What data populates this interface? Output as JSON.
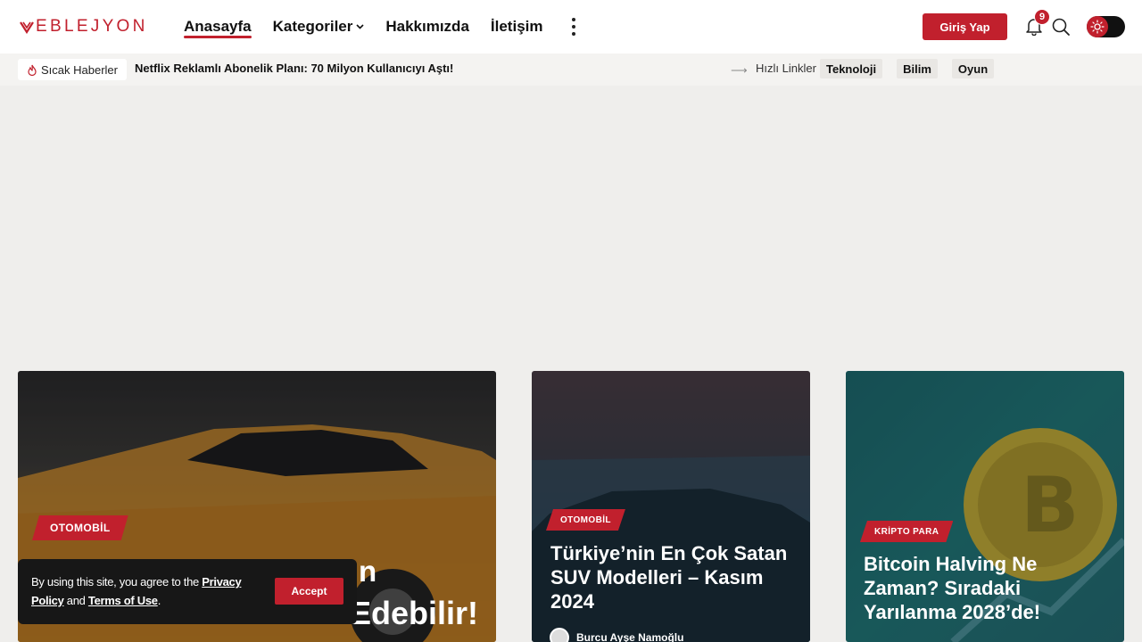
{
  "brand": {
    "logo_text": "EBLEJYON",
    "accent": "#c1202d"
  },
  "nav": {
    "items": [
      {
        "label": "Anasayfa",
        "active": true
      },
      {
        "label": "Kategoriler",
        "has_dropdown": true
      },
      {
        "label": "Hakkımızda"
      },
      {
        "label": "İletişim"
      }
    ],
    "more_icon": "more-vertical-icon"
  },
  "header": {
    "login_label": "Giriş Yap",
    "notification_count": "9",
    "icons": [
      "bell-icon",
      "search-icon",
      "sun-icon"
    ]
  },
  "ticker": {
    "hot_label": "Sıcak Haberler",
    "headline": "Netflix Reklamlı Abonelik Planı: 70 Milyon Kullanıcıyı Aştı!",
    "quick_label": "Hızlı Linkler",
    "quick_links": [
      "Teknoloji",
      "Bilim",
      "Oyun"
    ]
  },
  "cards": [
    {
      "category": "OTOMOBİL",
      "title_visible": "Edebilir!",
      "title_partial": "n"
    },
    {
      "category": "OTOMOBİL",
      "title": "Türkiye’nin En Çok Satan SUV Modelleri – Kasım 2024",
      "author": "Burcu Ayşe Namoğlu"
    },
    {
      "category": "KRİPTO PARA",
      "title": "Bitcoin Halving Ne Zaman? Sıradaki Yarılanma 2028’de!"
    }
  ],
  "cookie": {
    "text_before": "By using this site, you agree to the ",
    "privacy_label": "Privacy Policy",
    "text_and": " and ",
    "terms_label": "Terms of Use",
    "text_end": ".",
    "accept_label": "Accept"
  }
}
